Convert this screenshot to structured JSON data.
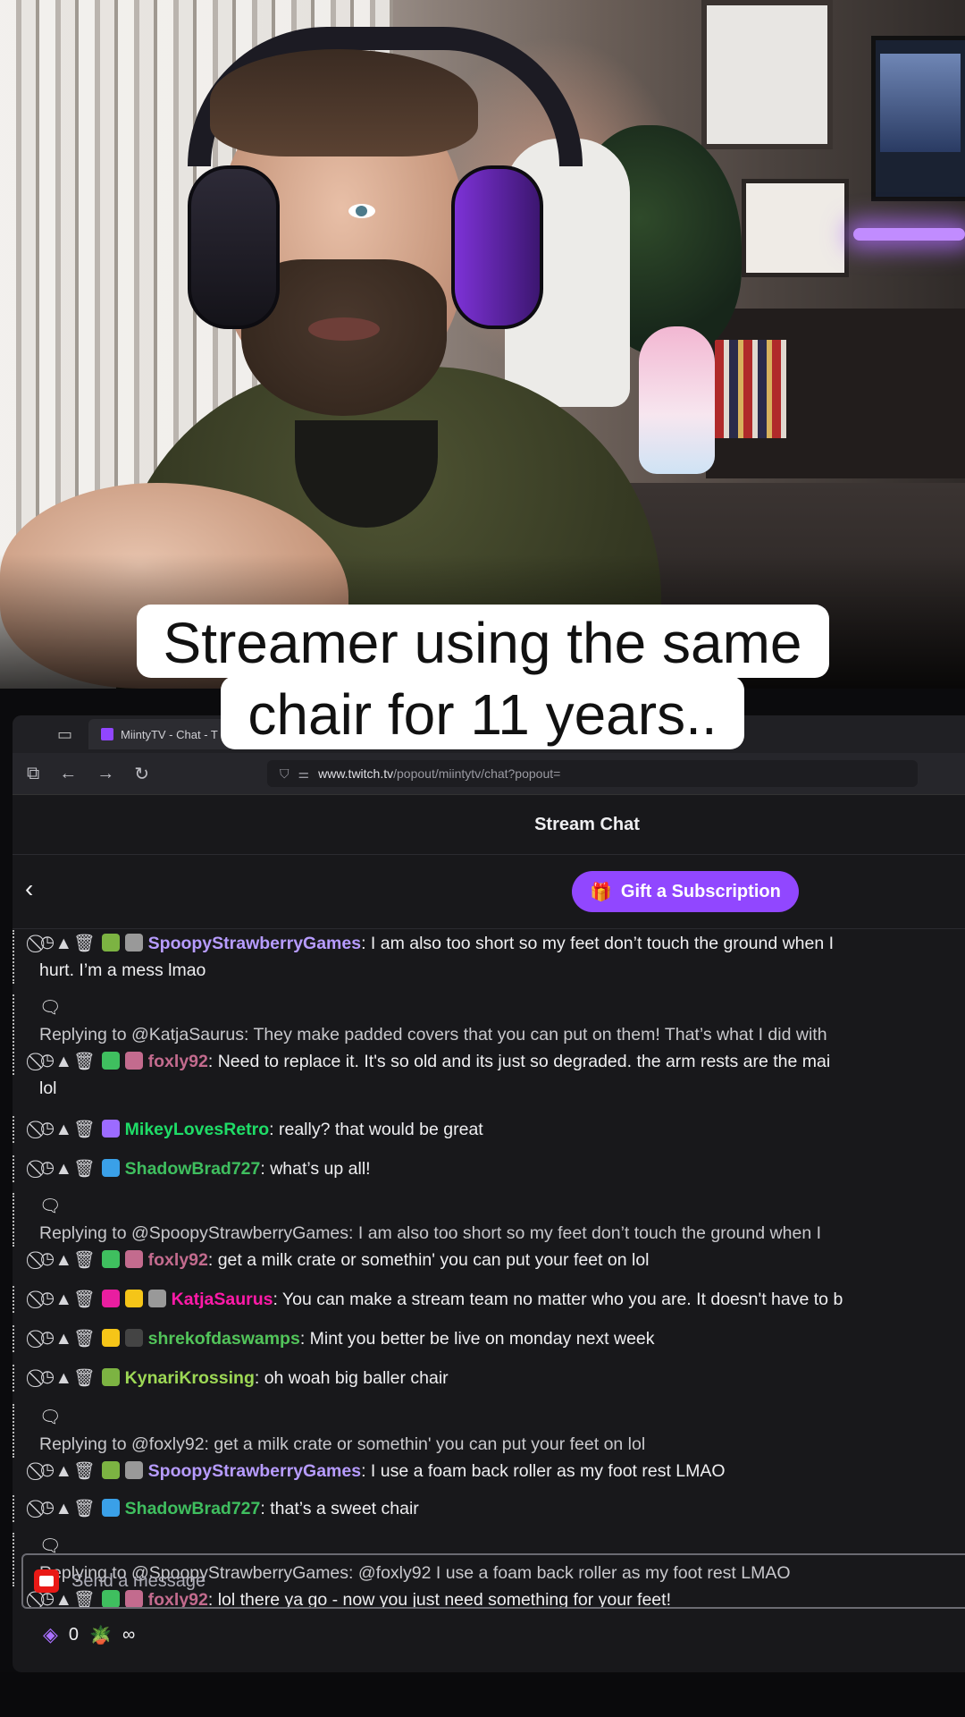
{
  "caption": {
    "line1": "Streamer using the same",
    "line2": "chair for 11 years.."
  },
  "browser": {
    "tab_label": "MiintyTV - Chat - T",
    "url_host": "www.twitch.tv",
    "url_path": "/popout/miintytv/chat?popout="
  },
  "chat": {
    "header": "Stream Chat",
    "gift_button": "Gift a Subscription",
    "mod_icons": "⃠◷▲🗑",
    "messages": [
      {
        "user": "SpoopyStrawberryGames",
        "text": ": I am also too short so my feet don’t touch the ground when I",
        "cont": "hurt. I’m a mess lmao"
      },
      {
        "reply": "Replying to @KatjaSaurus: They make padded covers that you can put on them! That’s what I did with",
        "user": "foxly92",
        "text": ": Need to replace it. It's so old and its just so degraded. the arm rests are the mai",
        "cont": "lol"
      },
      {
        "user": "MikeyLovesRetro",
        "text": ": really? that would be great"
      },
      {
        "user": "ShadowBrad727",
        "text": ": what’s up all!"
      },
      {
        "reply": "Replying to @SpoopyStrawberryGames: I am also too short so my feet don’t touch the ground when I",
        "user": "foxly92",
        "text": ": get a milk crate or somethin' you can put your feet on lol"
      },
      {
        "user": "KatjaSaurus",
        "text": ": You can make a stream team no matter who you are. It doesn't have to b"
      },
      {
        "user": "shrekofdaswamps",
        "text": ": Mint you better be live on monday next week"
      },
      {
        "user": "KynariKrossing",
        "text": ": oh woah big baller chair"
      },
      {
        "reply": "Replying to @foxly92: get a milk crate or somethin' you can put your feet on lol",
        "user": "SpoopyStrawberryGames",
        "text": ": I use a foam back roller as my foot rest LMAO"
      },
      {
        "user": "ShadowBrad727",
        "text": ": that’s a sweet chair"
      },
      {
        "reply": "Replying to @SpoopyStrawberryGames: @foxly92 I use a foam back roller as my foot rest LMAO",
        "user": "foxly92",
        "text": ": lol there ya go - now you just need something for your feet!"
      }
    ],
    "input_placeholder": "Send a message",
    "points": "0",
    "infinity": "∞"
  },
  "colors": {
    "twitch_purple": "#9147ff",
    "chat_bg": "#18181b"
  }
}
